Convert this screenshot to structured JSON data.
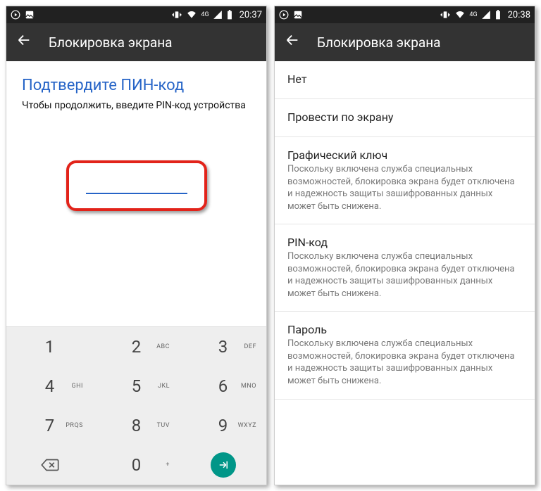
{
  "left": {
    "status": {
      "time": "20:37",
      "network": "4G"
    },
    "appbar": {
      "title": "Блокировка экрана"
    },
    "pin": {
      "title": "Подтвердите ПИН-код",
      "subtitle": "Чтобы продолжить, введите PIN-код устройства",
      "value": ""
    },
    "keypad": {
      "rows": [
        [
          {
            "d": "1",
            "l": ""
          },
          {
            "d": "2",
            "l": "ABC"
          },
          {
            "d": "3",
            "l": "DEF"
          }
        ],
        [
          {
            "d": "4",
            "l": "GHI"
          },
          {
            "d": "5",
            "l": "JKL"
          },
          {
            "d": "6",
            "l": "MNO"
          }
        ],
        [
          {
            "d": "7",
            "l": "PRQS"
          },
          {
            "d": "8",
            "l": "TUV"
          },
          {
            "d": "9",
            "l": "WXYZ"
          }
        ]
      ],
      "zero": "0",
      "zero_letters": "+"
    }
  },
  "right": {
    "status": {
      "time": "20:38",
      "network": "4G"
    },
    "appbar": {
      "title": "Блокировка экрана"
    },
    "options": [
      {
        "title": "Нет",
        "desc": ""
      },
      {
        "title": "Провести по экрану",
        "desc": ""
      },
      {
        "title": "Графический ключ",
        "desc": "Поскольку включена служба специальных возможностей, блокировка экрана будет отключена и надежность защиты зашифрованных данных может быть снижена."
      },
      {
        "title": "PIN-код",
        "desc": "Поскольку включена служба специальных возможностей, блокировка экрана будет отключена и надежность защиты зашифрованных данных может быть снижена."
      },
      {
        "title": "Пароль",
        "desc": "Поскольку включена служба специальных возможностей, блокировка экрана будет отключена и надежность защиты зашифрованных данных может быть снижена."
      }
    ]
  }
}
